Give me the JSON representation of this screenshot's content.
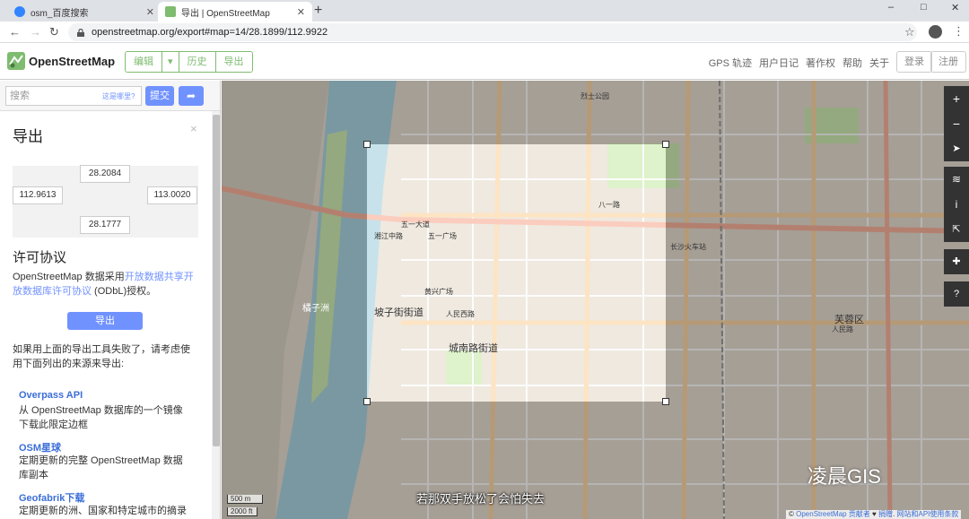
{
  "browser": {
    "tabs": [
      {
        "title": "osm_百度搜索",
        "active": false
      },
      {
        "title": "导出 | OpenStreetMap",
        "active": true
      }
    ],
    "url": "openstreetmap.org/export#map=14/28.1899/112.9922",
    "new_tab_icon": "+",
    "controls": [
      "–",
      "□",
      "✕"
    ]
  },
  "osm": {
    "brand": "OpenStreetMap",
    "edit": "编辑",
    "history": "历史",
    "export": "导出",
    "secondary_links": [
      "GPS 轨迹",
      "用户日记",
      "著作权",
      "帮助",
      "关于"
    ],
    "login": "登录",
    "signup": "注册"
  },
  "sidebar": {
    "search_placeholder": "搜索",
    "where_am_i": "这是哪里?",
    "submit": "提交",
    "title": "导出",
    "bbox": {
      "north": "28.2084",
      "west": "112.9613",
      "east": "113.0020",
      "south": "28.1777"
    },
    "license_title": "许可协议",
    "license_text_1": "OpenStreetMap 数据采用",
    "license_link": "开放数据共享开放数据库许可协议",
    "license_text_2": " (ODbL)授权。",
    "export_button": "导出",
    "fallback_text": "如果用上面的导出工具失败了，请考虑使用下面列出的来源来导出:",
    "sources": [
      {
        "title": "Overpass API",
        "desc": "从 OpenStreetMap 数据库的一个镜像下载此限定边框"
      },
      {
        "title": "OSM星球",
        "desc": "定期更新的完整 OpenStreetMap 数据库副本"
      },
      {
        "title": "Geofabrik下载",
        "desc": "定期更新的洲、国家和特定城市的摘录"
      }
    ]
  },
  "map": {
    "labels": [
      "坡子街街道",
      "城南路街道",
      "橘子洲",
      "芙蓉区",
      "五一大道",
      "长沙火车站",
      "烈士公园",
      "八一路",
      "人民西路",
      "湘江中路",
      "五一广场",
      "黄兴广场",
      "人民路"
    ],
    "scale_m": "500 m",
    "scale_ft": "2000 ft",
    "attribution_prefix": "© ",
    "attribution_link": "OpenStreetMap 贡献者",
    "attribution_heart": " ♥ ",
    "attribution_donate": "捐赠",
    "attribution_terms": "网站和API使用条款",
    "watermark": "凌晨GIS",
    "subtitle": "若那双手放松了会怕失去",
    "colors": {
      "water": "#aad3df",
      "primary": "#fcd6a4",
      "trunk": "#f9b29c",
      "green": "#cdebb0"
    }
  }
}
